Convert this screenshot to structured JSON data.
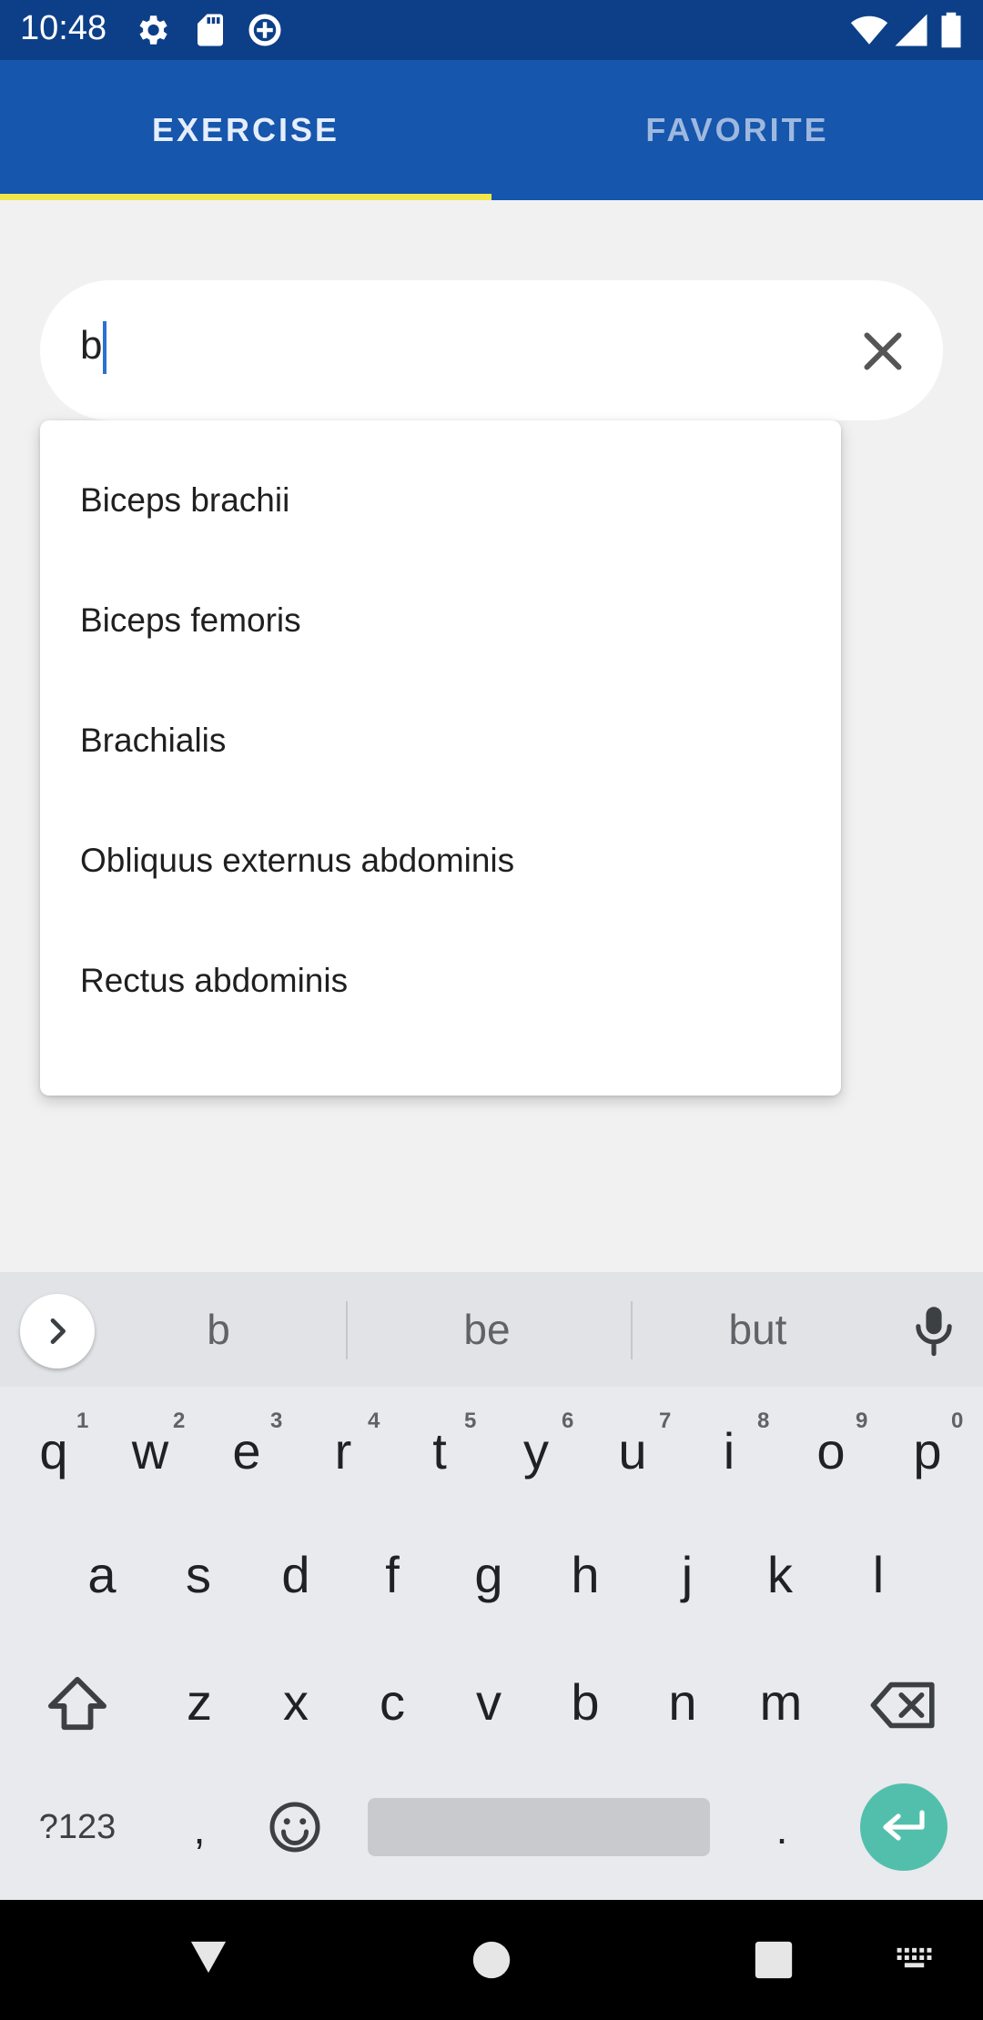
{
  "status_bar": {
    "time": "10:48",
    "icons_left": [
      "gear-icon",
      "sd-card-icon",
      "data-saver-icon"
    ],
    "icons_right": [
      "wifi-icon",
      "signal-icon",
      "battery-icon"
    ]
  },
  "tabs": [
    {
      "label": "EXERCISE",
      "selected": true
    },
    {
      "label": "FAVORITE",
      "selected": false
    }
  ],
  "search": {
    "value": "b",
    "clear_icon": "close-icon"
  },
  "suggestions": [
    "Biceps brachii",
    "Biceps femoris",
    "Brachialis",
    "Obliquus externus abdominis",
    "Rectus abdominis"
  ],
  "keyboard": {
    "word_suggestions": [
      "b",
      "be",
      "but"
    ],
    "row1": [
      {
        "key": "q",
        "num": "1"
      },
      {
        "key": "w",
        "num": "2"
      },
      {
        "key": "e",
        "num": "3"
      },
      {
        "key": "r",
        "num": "4"
      },
      {
        "key": "t",
        "num": "5"
      },
      {
        "key": "y",
        "num": "6"
      },
      {
        "key": "u",
        "num": "7"
      },
      {
        "key": "i",
        "num": "8"
      },
      {
        "key": "o",
        "num": "9"
      },
      {
        "key": "p",
        "num": "0"
      }
    ],
    "row2": [
      "a",
      "s",
      "d",
      "f",
      "g",
      "h",
      "j",
      "k",
      "l"
    ],
    "row3": [
      "z",
      "x",
      "c",
      "v",
      "b",
      "n",
      "m"
    ],
    "symbols_label": "?123",
    "comma": ",",
    "period": "."
  },
  "colors": {
    "tab_bar": "#1656ac",
    "status_bar": "#0d3f88",
    "tab_indicator": "#f3e64a",
    "enter_key": "#52bfad"
  }
}
